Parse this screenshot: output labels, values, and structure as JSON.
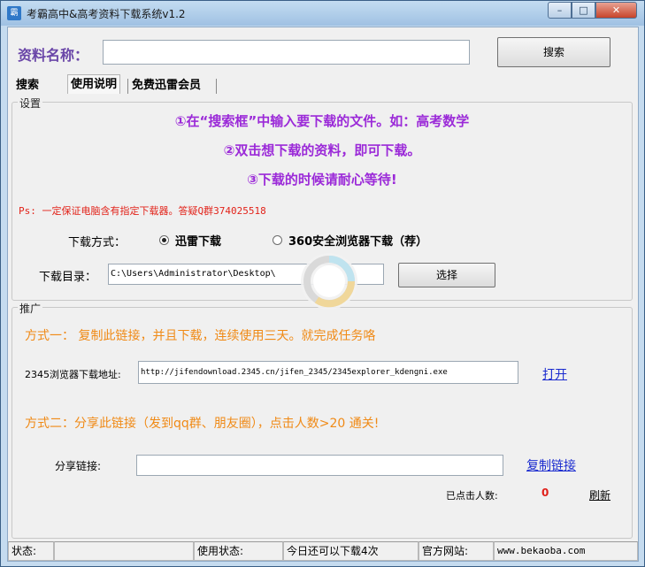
{
  "window": {
    "title": "考霸高中&高考资料下载系统v1.2",
    "icon_text": "霸",
    "minimize": "–",
    "maximize": "□",
    "close": "✕"
  },
  "search": {
    "label": "资料名称：",
    "value": "",
    "button": "搜索"
  },
  "tabs": [
    {
      "label": "搜索"
    },
    {
      "label": "使用说明"
    },
    {
      "label": "免费迅雷会员"
    }
  ],
  "settings": {
    "group_title": "设置",
    "instructions": [
      "①在“搜索框”中输入要下载的文件。如：高考数学",
      "②双击想下载的资料，即可下载。",
      "③下载的时候请耐心等待!"
    ],
    "ps": "Ps: 一定保证电脑含有指定下载器。答疑Q群374025518",
    "download_method_label": "下载方式：",
    "options": [
      {
        "label": "迅雷下载",
        "checked": true
      },
      {
        "label": "360安全浏览器下载（荐）",
        "checked": false
      }
    ],
    "dir_label": "下载目录：",
    "dir_value": "C:\\Users\\Administrator\\Desktop\\",
    "choose_button": "选择"
  },
  "promo": {
    "group_title": "推广",
    "method1": "方式一：  复制此链接，并且下载，连续使用三天。就完成任务咯",
    "browser_label": "2345浏览器下载地址:",
    "browser_url": "http://jifendownload.2345.cn/jifen_2345/2345explorer_kdengni.exe",
    "open_link": "打开",
    "method2": "方式二：分享此链接（发到qq群、朋友圈），点击人数>20 通关!",
    "share_label": "分享链接:",
    "share_value": "",
    "copy_link": "复制链接",
    "clicks_label": "已点击人数:",
    "clicks_value": "0",
    "refresh": "刷新",
    "clicks_color": "#e0201a"
  },
  "status": {
    "label": "状态:",
    "value": "",
    "usage_label": "使用状态:",
    "usage_value": "今日还可以下载4次",
    "site_label": "官方网站:",
    "site_value": "www.bekaoba.com"
  },
  "colors": {
    "instruction": "#9b2ad8",
    "promo": "#f08a16",
    "link": "#1a2bcf",
    "ps": "#e2231a"
  }
}
